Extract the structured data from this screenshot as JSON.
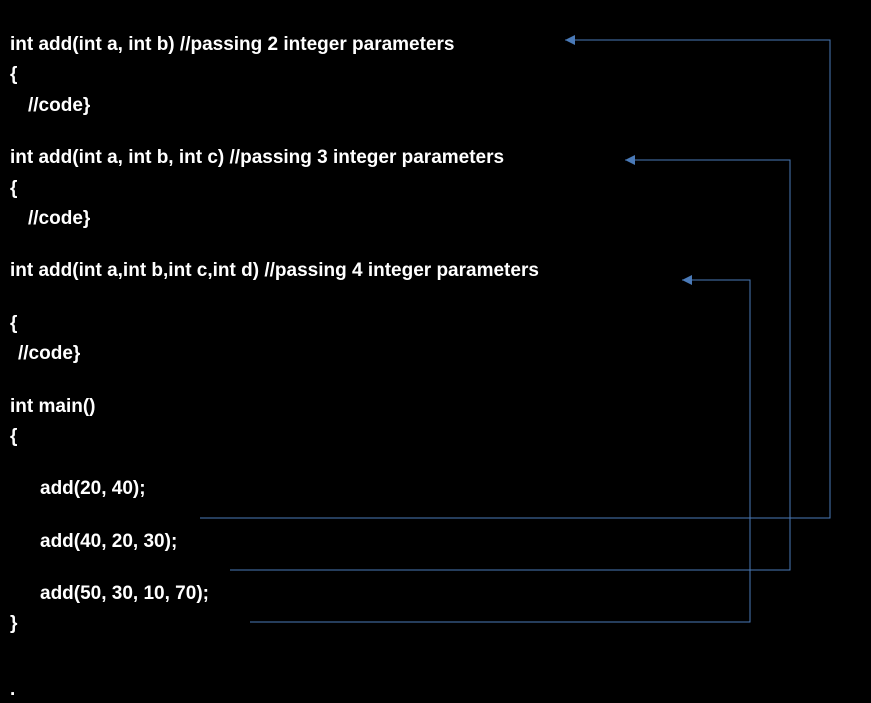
{
  "code": {
    "func1": {
      "sig": "int add(int a, int b) //passing 2 integer parameters",
      "open": "{",
      "body": "//code}"
    },
    "func2": {
      "sig": "int add(int a, int b, int c) //passing 3 integer parameters",
      "open": "{",
      "body": "//code}"
    },
    "func3": {
      "sig": "int add(int a,int b,int c,int d) //passing 4 integer parameters",
      "open": "{",
      "body": "//code}"
    },
    "main": {
      "sig": "int main()",
      "open": "{",
      "call1": "add(20, 40);",
      "call2": "add(40, 20, 30);",
      "call3": "add(50, 30, 10, 70);",
      "close": "}"
    },
    "dot": "."
  }
}
